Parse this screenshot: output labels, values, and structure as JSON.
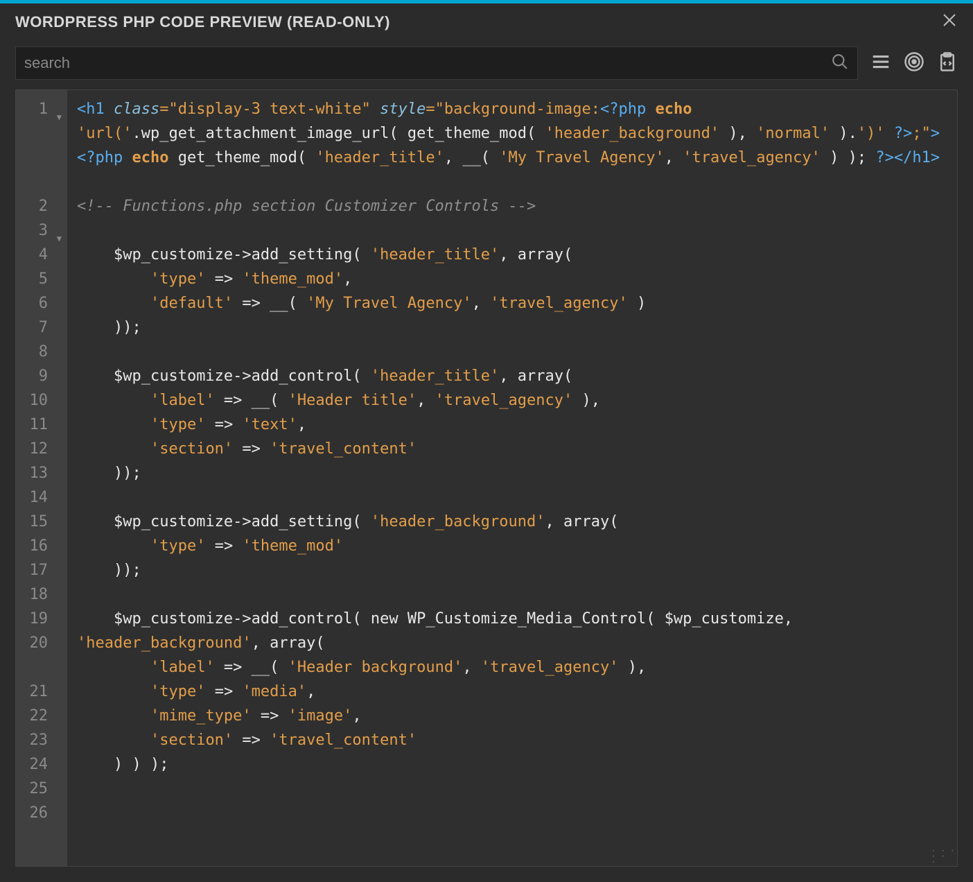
{
  "window": {
    "title": "WORDPRESS PHP CODE PREVIEW (READ-ONLY)"
  },
  "toolbar": {
    "search_placeholder": "search"
  },
  "gutter": {
    "lines": [
      {
        "n": "1",
        "fold": true,
        "wraps": 3
      },
      {
        "n": "2",
        "fold": false,
        "wraps": 0
      },
      {
        "n": "3",
        "fold": true,
        "wraps": 0
      },
      {
        "n": "4",
        "fold": false,
        "wraps": 0
      },
      {
        "n": "5",
        "fold": false,
        "wraps": 0
      },
      {
        "n": "6",
        "fold": false,
        "wraps": 0
      },
      {
        "n": "7",
        "fold": false,
        "wraps": 0
      },
      {
        "n": "8",
        "fold": false,
        "wraps": 0
      },
      {
        "n": "9",
        "fold": false,
        "wraps": 0
      },
      {
        "n": "10",
        "fold": false,
        "wraps": 0
      },
      {
        "n": "11",
        "fold": false,
        "wraps": 0
      },
      {
        "n": "12",
        "fold": false,
        "wraps": 0
      },
      {
        "n": "13",
        "fold": false,
        "wraps": 0
      },
      {
        "n": "14",
        "fold": false,
        "wraps": 0
      },
      {
        "n": "15",
        "fold": false,
        "wraps": 0
      },
      {
        "n": "16",
        "fold": false,
        "wraps": 0
      },
      {
        "n": "17",
        "fold": false,
        "wraps": 0
      },
      {
        "n": "18",
        "fold": false,
        "wraps": 0
      },
      {
        "n": "19",
        "fold": false,
        "wraps": 0
      },
      {
        "n": "20",
        "fold": false,
        "wraps": 1
      },
      {
        "n": "21",
        "fold": false,
        "wraps": 0
      },
      {
        "n": "22",
        "fold": false,
        "wraps": 0
      },
      {
        "n": "23",
        "fold": false,
        "wraps": 0
      },
      {
        "n": "24",
        "fold": false,
        "wraps": 0
      },
      {
        "n": "25",
        "fold": false,
        "wraps": 0
      },
      {
        "n": "26",
        "fold": false,
        "wraps": 0
      }
    ]
  },
  "code": {
    "lines": [
      [
        {
          "c": "t-tag",
          "t": "<h1"
        },
        {
          "c": "t-plain",
          "t": " "
        },
        {
          "c": "t-attr",
          "t": "class"
        },
        {
          "c": "t-op",
          "t": "="
        },
        {
          "c": "t-str",
          "t": "\"display-3 text-white\""
        },
        {
          "c": "t-plain",
          "t": " "
        },
        {
          "c": "t-attr",
          "t": "style"
        },
        {
          "c": "t-op",
          "t": "="
        },
        {
          "c": "t-str",
          "t": "\"background-image:"
        },
        {
          "c": "t-tag",
          "t": "<?php"
        },
        {
          "c": "t-plain",
          "t": " "
        },
        {
          "c": "t-kw",
          "t": "echo"
        },
        {
          "c": "t-plain",
          "t": " "
        },
        {
          "c": "t-str",
          "t": "'url('"
        },
        {
          "c": "t-plain",
          "t": ".wp_get_attachment_image_url( get_theme_mod( "
        },
        {
          "c": "t-str",
          "t": "'header_background'"
        },
        {
          "c": "t-plain",
          "t": " ), "
        },
        {
          "c": "t-str",
          "t": "'normal'"
        },
        {
          "c": "t-plain",
          "t": " )."
        },
        {
          "c": "t-str",
          "t": "')'"
        },
        {
          "c": "t-plain",
          "t": " "
        },
        {
          "c": "t-tag",
          "t": "?>"
        },
        {
          "c": "t-str",
          "t": ";\""
        },
        {
          "c": "t-tag",
          "t": ">"
        },
        {
          "c": "t-tag",
          "t": "<?php"
        },
        {
          "c": "t-plain",
          "t": " "
        },
        {
          "c": "t-kw",
          "t": "echo"
        },
        {
          "c": "t-plain",
          "t": " get_theme_mod( "
        },
        {
          "c": "t-str",
          "t": "'header_title'"
        },
        {
          "c": "t-plain",
          "t": ", __( "
        },
        {
          "c": "t-str",
          "t": "'My Travel Agency'"
        },
        {
          "c": "t-plain",
          "t": ", "
        },
        {
          "c": "t-str",
          "t": "'travel_agency'"
        },
        {
          "c": "t-plain",
          "t": " ) ); "
        },
        {
          "c": "t-tag",
          "t": "?>"
        },
        {
          "c": "t-tag",
          "t": "</h1>"
        }
      ],
      [],
      [
        {
          "c": "t-comment",
          "t": "<!-- Functions.php section Customizer Controls -->"
        }
      ],
      [],
      [
        {
          "c": "t-plain",
          "t": "    $wp_customize->add_setting( "
        },
        {
          "c": "t-str",
          "t": "'header_title'"
        },
        {
          "c": "t-plain",
          "t": ", array("
        }
      ],
      [
        {
          "c": "t-plain",
          "t": "        "
        },
        {
          "c": "t-str",
          "t": "'type'"
        },
        {
          "c": "t-plain",
          "t": " => "
        },
        {
          "c": "t-str",
          "t": "'theme_mod'"
        },
        {
          "c": "t-plain",
          "t": ","
        }
      ],
      [
        {
          "c": "t-plain",
          "t": "        "
        },
        {
          "c": "t-str",
          "t": "'default'"
        },
        {
          "c": "t-plain",
          "t": " => __( "
        },
        {
          "c": "t-str",
          "t": "'My Travel Agency'"
        },
        {
          "c": "t-plain",
          "t": ", "
        },
        {
          "c": "t-str",
          "t": "'travel_agency'"
        },
        {
          "c": "t-plain",
          "t": " )"
        }
      ],
      [
        {
          "c": "t-plain",
          "t": "    ));"
        }
      ],
      [],
      [
        {
          "c": "t-plain",
          "t": "    $wp_customize->add_control( "
        },
        {
          "c": "t-str",
          "t": "'header_title'"
        },
        {
          "c": "t-plain",
          "t": ", array("
        }
      ],
      [
        {
          "c": "t-plain",
          "t": "        "
        },
        {
          "c": "t-str",
          "t": "'label'"
        },
        {
          "c": "t-plain",
          "t": " => __( "
        },
        {
          "c": "t-str",
          "t": "'Header title'"
        },
        {
          "c": "t-plain",
          "t": ", "
        },
        {
          "c": "t-str",
          "t": "'travel_agency'"
        },
        {
          "c": "t-plain",
          "t": " ),"
        }
      ],
      [
        {
          "c": "t-plain",
          "t": "        "
        },
        {
          "c": "t-str",
          "t": "'type'"
        },
        {
          "c": "t-plain",
          "t": " => "
        },
        {
          "c": "t-str",
          "t": "'text'"
        },
        {
          "c": "t-plain",
          "t": ","
        }
      ],
      [
        {
          "c": "t-plain",
          "t": "        "
        },
        {
          "c": "t-str",
          "t": "'section'"
        },
        {
          "c": "t-plain",
          "t": " => "
        },
        {
          "c": "t-str",
          "t": "'travel_content'"
        }
      ],
      [
        {
          "c": "t-plain",
          "t": "    ));"
        }
      ],
      [],
      [
        {
          "c": "t-plain",
          "t": "    $wp_customize->add_setting( "
        },
        {
          "c": "t-str",
          "t": "'header_background'"
        },
        {
          "c": "t-plain",
          "t": ", array("
        }
      ],
      [
        {
          "c": "t-plain",
          "t": "        "
        },
        {
          "c": "t-str",
          "t": "'type'"
        },
        {
          "c": "t-plain",
          "t": " => "
        },
        {
          "c": "t-str",
          "t": "'theme_mod'"
        }
      ],
      [
        {
          "c": "t-plain",
          "t": "    ));"
        }
      ],
      [],
      [
        {
          "c": "t-plain",
          "t": "    $wp_customize->add_control( new WP_Customize_Media_Control( $wp_customize, "
        },
        {
          "c": "t-str",
          "t": "'header_background'"
        },
        {
          "c": "t-plain",
          "t": ", array("
        }
      ],
      [
        {
          "c": "t-plain",
          "t": "        "
        },
        {
          "c": "t-str",
          "t": "'label'"
        },
        {
          "c": "t-plain",
          "t": " => __( "
        },
        {
          "c": "t-str",
          "t": "'Header background'"
        },
        {
          "c": "t-plain",
          "t": ", "
        },
        {
          "c": "t-str",
          "t": "'travel_agency'"
        },
        {
          "c": "t-plain",
          "t": " ),"
        }
      ],
      [
        {
          "c": "t-plain",
          "t": "        "
        },
        {
          "c": "t-str",
          "t": "'type'"
        },
        {
          "c": "t-plain",
          "t": " => "
        },
        {
          "c": "t-str",
          "t": "'media'"
        },
        {
          "c": "t-plain",
          "t": ","
        }
      ],
      [
        {
          "c": "t-plain",
          "t": "        "
        },
        {
          "c": "t-str",
          "t": "'mime_type'"
        },
        {
          "c": "t-plain",
          "t": " => "
        },
        {
          "c": "t-str",
          "t": "'image'"
        },
        {
          "c": "t-plain",
          "t": ","
        }
      ],
      [
        {
          "c": "t-plain",
          "t": "        "
        },
        {
          "c": "t-str",
          "t": "'section'"
        },
        {
          "c": "t-plain",
          "t": " => "
        },
        {
          "c": "t-str",
          "t": "'travel_content'"
        }
      ],
      [
        {
          "c": "t-plain",
          "t": "    ) ) );"
        }
      ],
      []
    ]
  }
}
